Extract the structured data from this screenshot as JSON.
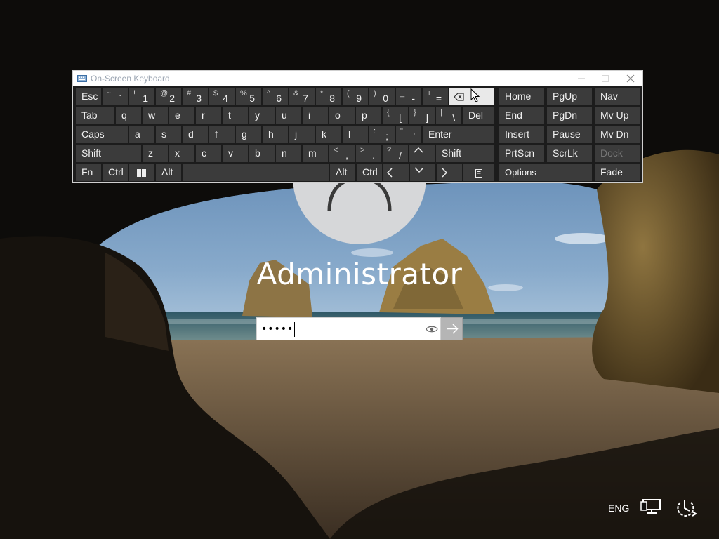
{
  "user": {
    "name": "Administrator"
  },
  "password": {
    "value": "•••••",
    "reveal_icon": "eye-icon",
    "submit_icon": "arrow-right-icon"
  },
  "tray": {
    "language": "ENG",
    "network_icon": "network-icon",
    "power_icon": "ease-of-access-icon"
  },
  "osk": {
    "title": "On-Screen Keyboard",
    "rows": [
      [
        {
          "id": "esc",
          "label": "Esc"
        },
        {
          "id": "backtick",
          "shift": "~",
          "main": "`"
        },
        {
          "id": "1",
          "shift": "!",
          "main": "1"
        },
        {
          "id": "2",
          "shift": "@",
          "main": "2"
        },
        {
          "id": "3",
          "shift": "#",
          "main": "3"
        },
        {
          "id": "4",
          "shift": "$",
          "main": "4"
        },
        {
          "id": "5",
          "shift": "%",
          "main": "5"
        },
        {
          "id": "6",
          "shift": "^",
          "main": "6"
        },
        {
          "id": "7",
          "shift": "&",
          "main": "7"
        },
        {
          "id": "8",
          "shift": "*",
          "main": "8"
        },
        {
          "id": "9",
          "shift": "(",
          "main": "9"
        },
        {
          "id": "0",
          "shift": ")",
          "main": "0"
        },
        {
          "id": "minus",
          "shift": "_",
          "main": "-"
        },
        {
          "id": "equals",
          "shift": "+",
          "main": "="
        },
        {
          "id": "backspace",
          "icon": "backspace-icon"
        },
        {
          "id": "home",
          "label": "Home"
        },
        {
          "id": "pgup",
          "label": "PgUp"
        },
        {
          "id": "nav",
          "label": "Nav"
        }
      ],
      [
        {
          "id": "tab",
          "label": "Tab"
        },
        {
          "id": "q",
          "label": "q"
        },
        {
          "id": "w",
          "label": "w"
        },
        {
          "id": "e",
          "label": "e"
        },
        {
          "id": "r",
          "label": "r"
        },
        {
          "id": "t",
          "label": "t"
        },
        {
          "id": "y",
          "label": "y"
        },
        {
          "id": "u",
          "label": "u"
        },
        {
          "id": "i",
          "label": "i"
        },
        {
          "id": "o",
          "label": "o"
        },
        {
          "id": "p",
          "label": "p"
        },
        {
          "id": "lbracket",
          "shift": "{",
          "main": "["
        },
        {
          "id": "rbracket",
          "shift": "}",
          "main": "]"
        },
        {
          "id": "backslash",
          "shift": "|",
          "main": "\\"
        },
        {
          "id": "del",
          "label": "Del"
        },
        {
          "id": "end",
          "label": "End"
        },
        {
          "id": "pgdn",
          "label": "PgDn"
        },
        {
          "id": "mvup",
          "label": "Mv Up"
        }
      ],
      [
        {
          "id": "caps",
          "label": "Caps"
        },
        {
          "id": "a",
          "label": "a"
        },
        {
          "id": "s",
          "label": "s"
        },
        {
          "id": "d",
          "label": "d"
        },
        {
          "id": "f",
          "label": "f"
        },
        {
          "id": "g",
          "label": "g"
        },
        {
          "id": "h",
          "label": "h"
        },
        {
          "id": "j",
          "label": "j"
        },
        {
          "id": "k",
          "label": "k"
        },
        {
          "id": "l",
          "label": "l"
        },
        {
          "id": "semicolon",
          "shift": ":",
          "main": ";"
        },
        {
          "id": "quote",
          "shift": "\"",
          "main": "'"
        },
        {
          "id": "enter",
          "label": "Enter"
        },
        {
          "id": "insert",
          "label": "Insert"
        },
        {
          "id": "pause",
          "label": "Pause"
        },
        {
          "id": "mvdn",
          "label": "Mv Dn"
        }
      ],
      [
        {
          "id": "lshift",
          "label": "Shift"
        },
        {
          "id": "z",
          "label": "z"
        },
        {
          "id": "x",
          "label": "x"
        },
        {
          "id": "c",
          "label": "c"
        },
        {
          "id": "v",
          "label": "v"
        },
        {
          "id": "b",
          "label": "b"
        },
        {
          "id": "n",
          "label": "n"
        },
        {
          "id": "m",
          "label": "m"
        },
        {
          "id": "comma",
          "shift": "<",
          "main": ","
        },
        {
          "id": "period",
          "shift": ">",
          "main": "."
        },
        {
          "id": "slash",
          "shift": "?",
          "main": "/"
        },
        {
          "id": "up",
          "icon": "arrow-up-icon"
        },
        {
          "id": "rshift",
          "label": "Shift"
        },
        {
          "id": "prtscn",
          "label": "PrtScn"
        },
        {
          "id": "scrlk",
          "label": "ScrLk"
        },
        {
          "id": "dock",
          "label": "Dock"
        }
      ],
      [
        {
          "id": "fn",
          "label": "Fn"
        },
        {
          "id": "lctrl",
          "label": "Ctrl"
        },
        {
          "id": "win",
          "icon": "windows-icon"
        },
        {
          "id": "lalt",
          "label": "Alt"
        },
        {
          "id": "space",
          "label": ""
        },
        {
          "id": "ralt",
          "label": "Alt"
        },
        {
          "id": "rctrl",
          "label": "Ctrl"
        },
        {
          "id": "left",
          "icon": "arrow-left-icon"
        },
        {
          "id": "down",
          "icon": "arrow-down-icon"
        },
        {
          "id": "right",
          "icon": "arrow-right-icon"
        },
        {
          "id": "menu",
          "icon": "context-menu-icon"
        },
        {
          "id": "options",
          "label": "Options"
        },
        {
          "id": "fade",
          "label": "Fade"
        }
      ]
    ]
  }
}
